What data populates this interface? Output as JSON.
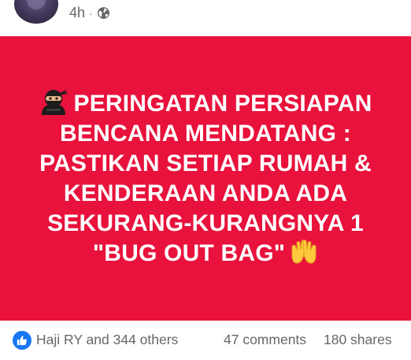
{
  "header": {
    "time": "4h",
    "separator": "·",
    "privacy_icon": "globe-icon"
  },
  "post": {
    "background_color": "#e8123c",
    "lead_emoji": "ninja-icon",
    "lines": [
      "PERINGATAN PERSIAPAN",
      "BENCANA MENDATANG :",
      "PASTIKAN SETIAP RUMAH &",
      "KENDERAAN ANDA ADA",
      "SEKURANG-KURANGNYA 1",
      "\"BUG OUT BAG\""
    ],
    "trail_emoji": "raised-hands-icon"
  },
  "footer": {
    "reaction_icon": "like-icon",
    "reactors": "Haji RY and 344 others",
    "comments": "47 comments",
    "shares": "180 shares"
  }
}
